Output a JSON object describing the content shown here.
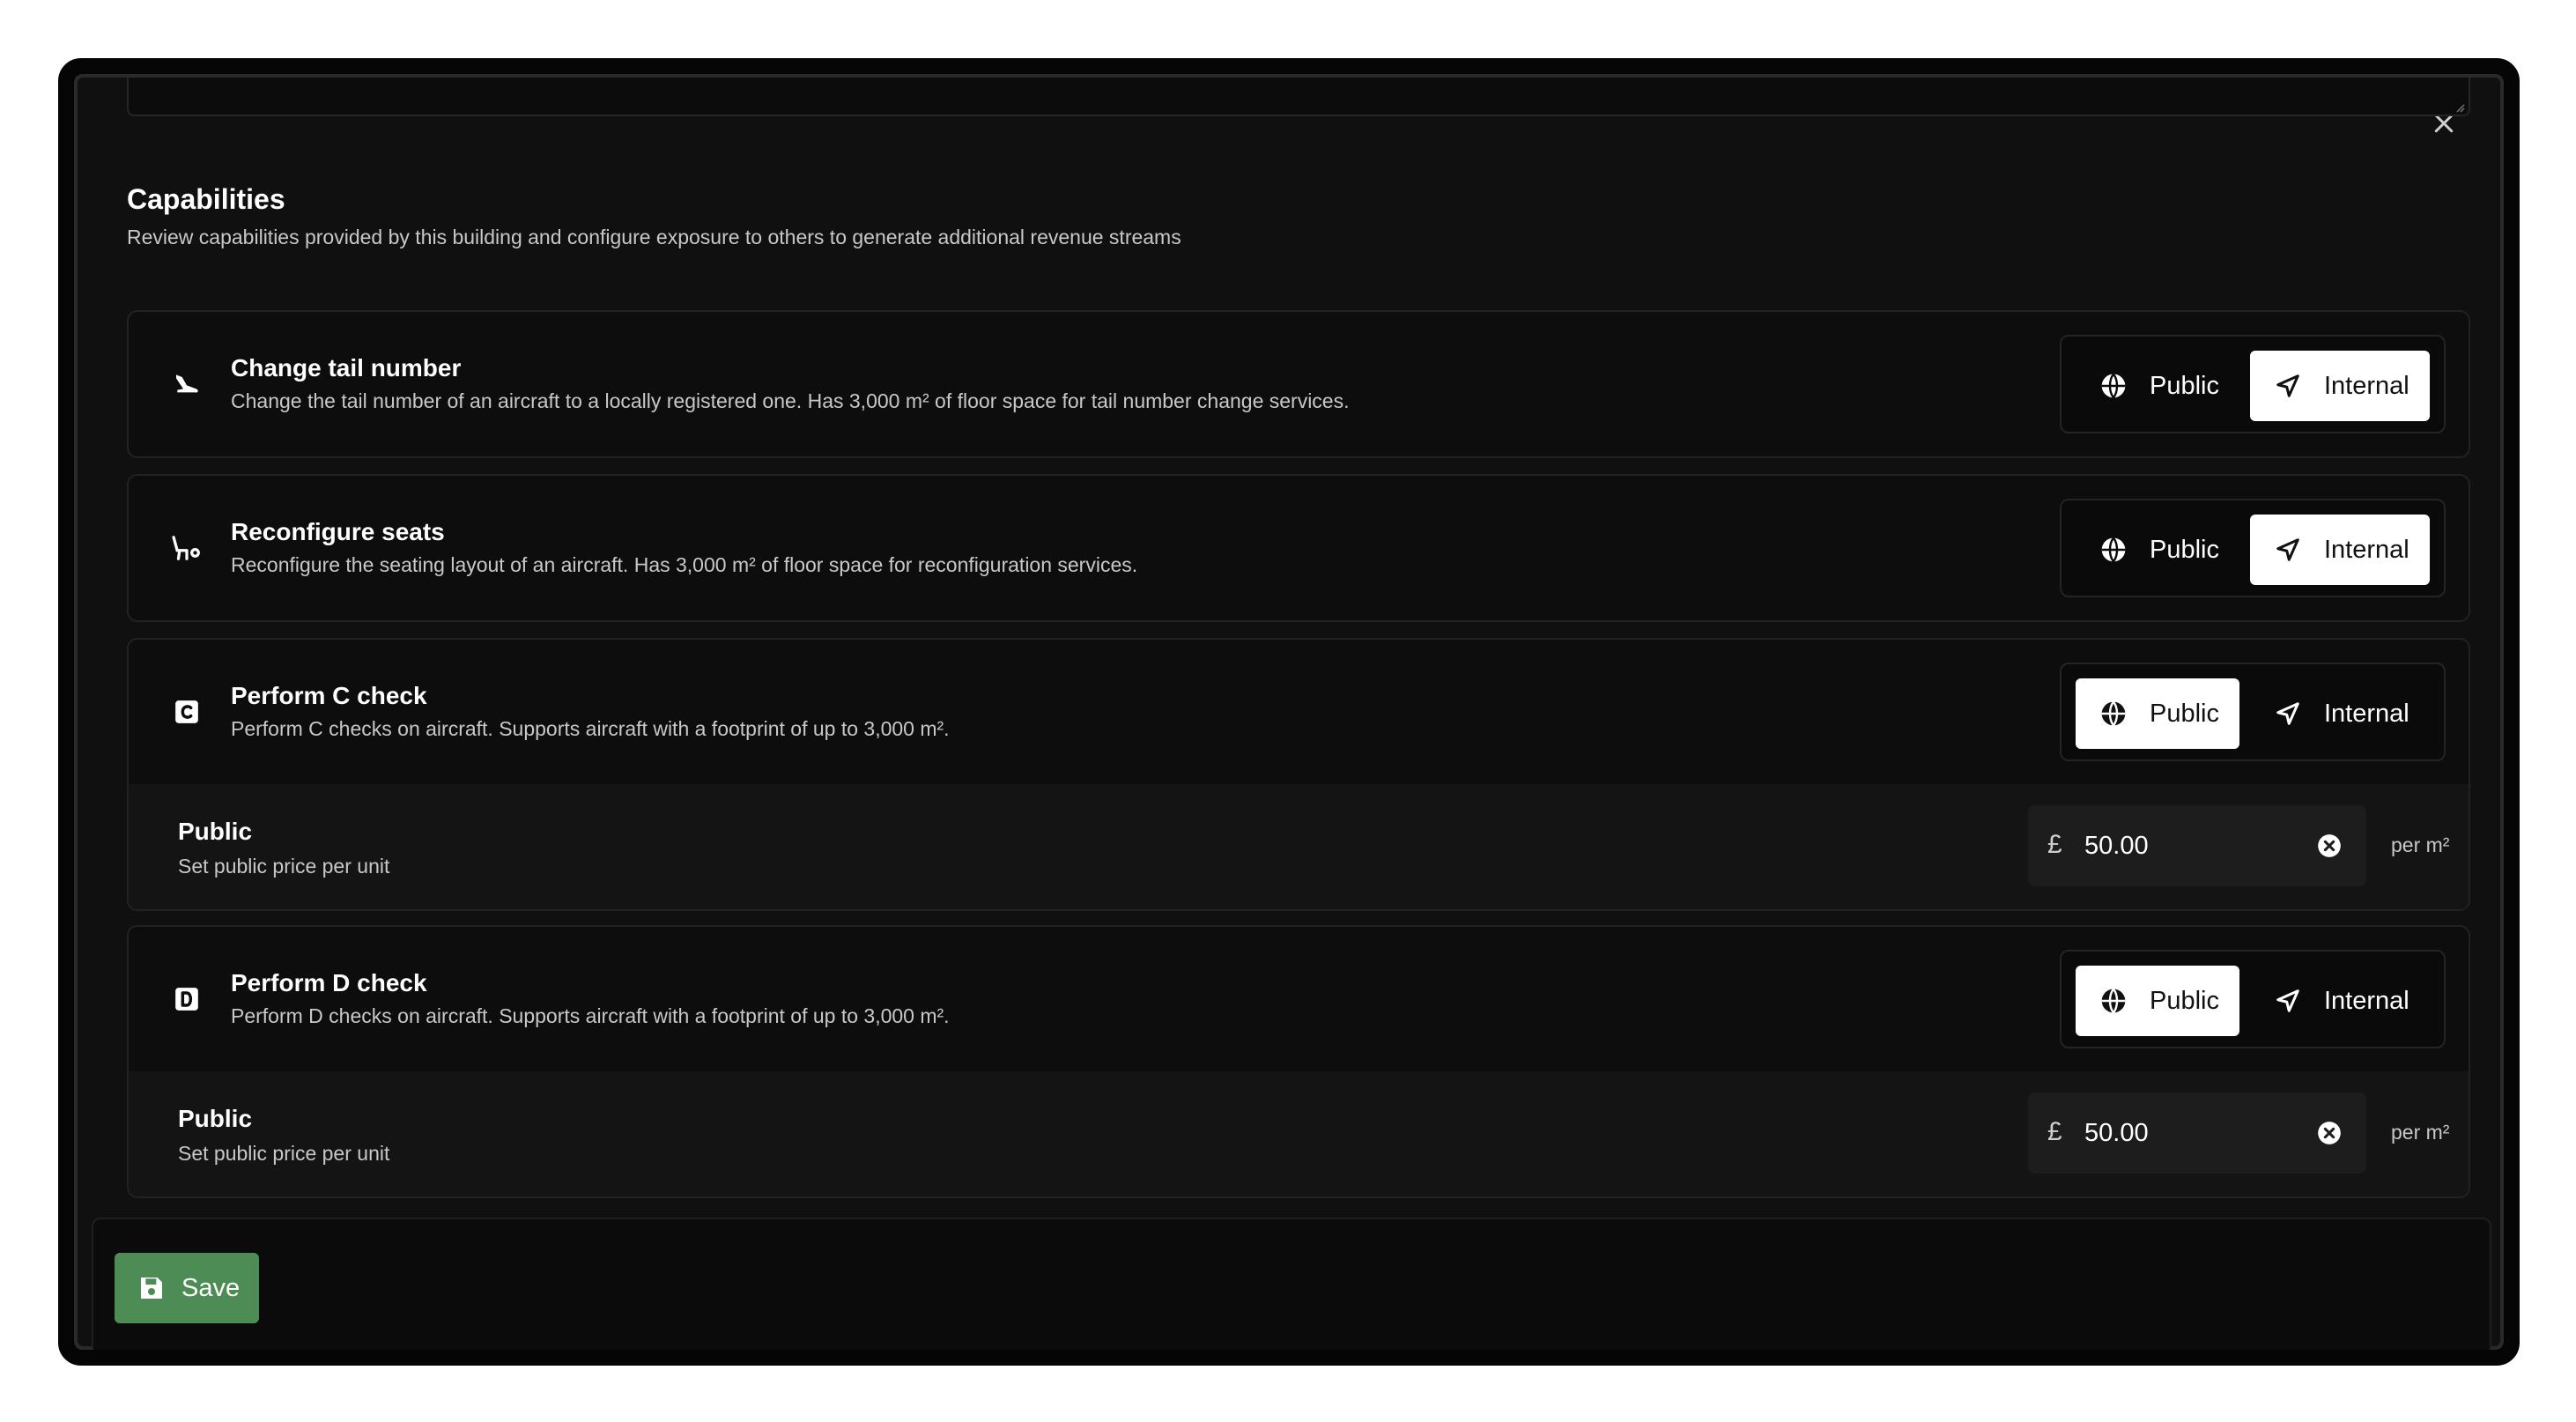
{
  "section": {
    "title": "Capabilities",
    "description": "Review capabilities provided by this building and configure exposure to others to generate additional revenue streams"
  },
  "toggle_labels": {
    "public": "Public",
    "internal": "Internal"
  },
  "capabilities": [
    {
      "icon": "plane-landing-icon",
      "title": "Change tail number",
      "description": "Change the tail number of an aircraft to a locally registered one. Has 3,000 m² of floor space for tail number change services.",
      "exposure": "Internal"
    },
    {
      "icon": "seat-settings-icon",
      "title": "Reconfigure seats",
      "description": "Reconfigure the seating layout of an aircraft. Has 3,000 m² of floor space for reconfiguration services.",
      "exposure": "Internal"
    },
    {
      "icon": "letter-c-square-icon",
      "title": "Perform C check",
      "description": "Perform C checks on aircraft. Supports aircraft with a footprint of up to 3,000 m².",
      "exposure": "Public",
      "pricing": {
        "title": "Public",
        "description": "Set public price per unit",
        "currency": "£",
        "value": "50.00",
        "unit": "per m²"
      }
    },
    {
      "icon": "letter-d-square-icon",
      "title": "Perform D check",
      "description": "Perform D checks on aircraft. Supports aircraft with a footprint of up to 3,000 m².",
      "exposure": "Public",
      "pricing": {
        "title": "Public",
        "description": "Set public price per unit",
        "currency": "£",
        "value": "50.00",
        "unit": "per m²"
      }
    }
  ],
  "footer": {
    "save_label": "Save"
  },
  "colors": {
    "save_button": "#4e8c55",
    "active_toggle": "#ffffff",
    "modal_background": "#101010"
  }
}
